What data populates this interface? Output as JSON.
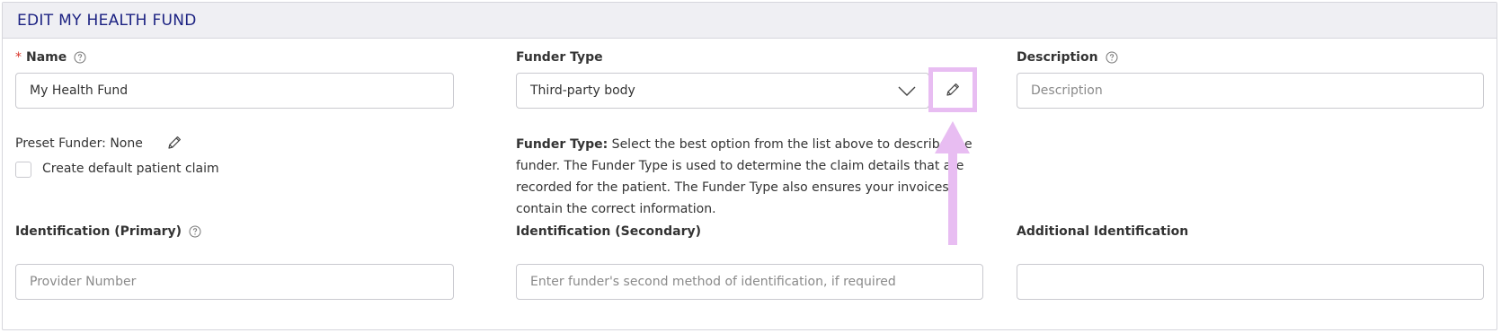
{
  "panel": {
    "title": "EDIT MY HEALTH FUND"
  },
  "name": {
    "required_mark": "*",
    "label": "Name",
    "value": "My Health Fund"
  },
  "funder_type": {
    "label": "Funder Type",
    "selected": "Third-party body",
    "help_title": "Funder Type:",
    "help_body": " Select the best option from the list above to describe the funder. The Funder Type is used to determine the claim details that are recorded for the patient. The Funder Type also ensures your invoices contain the correct information."
  },
  "description": {
    "label": "Description",
    "placeholder": "Description",
    "value": ""
  },
  "preset_funder": {
    "text": "Preset Funder: None"
  },
  "default_claim": {
    "label": "Create default patient claim",
    "checked": false
  },
  "identification_primary": {
    "label": "Identification (Primary)",
    "placeholder": "Provider Number",
    "value": ""
  },
  "identification_secondary": {
    "label": "Identification (Secondary)",
    "placeholder": "Enter funder's second method of identification, if required",
    "value": ""
  },
  "additional_identification": {
    "label": "Additional Identification",
    "placeholder": "",
    "value": ""
  },
  "icons": {
    "help": "help-circle-icon",
    "edit": "pencil-icon",
    "dropdown": "chevron-down-icon",
    "annotation": "arrow-up-icon"
  },
  "colors": {
    "title": "#1c2282",
    "header_bg": "#efeff3",
    "required": "#d9362b",
    "annotation_highlight": "#e8bdf2"
  }
}
